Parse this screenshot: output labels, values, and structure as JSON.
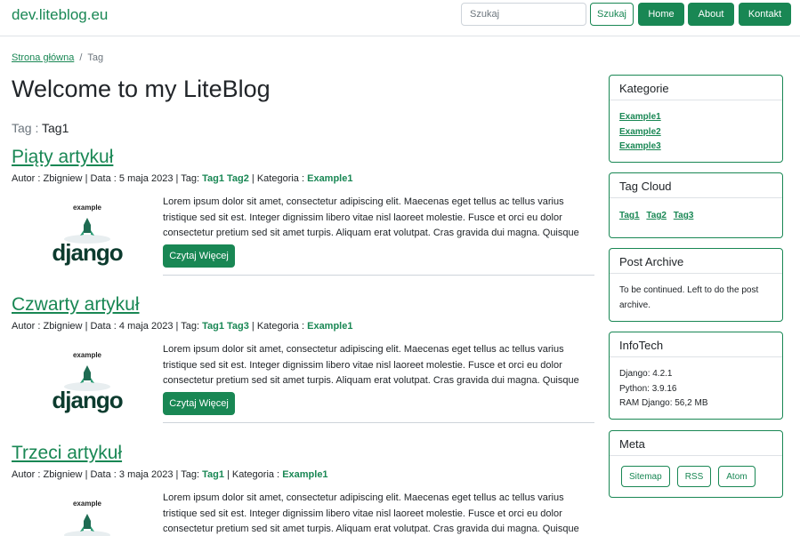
{
  "brand": "dev.liteblog.eu",
  "search": {
    "placeholder": "Szukaj",
    "button": "Szukaj"
  },
  "nav": {
    "home": "Home",
    "about": "About",
    "contact": "Kontakt"
  },
  "breadcrumb": {
    "home": "Strona główna",
    "separator": "/",
    "current": "Tag"
  },
  "page_title": "Welcome to my LiteBlog",
  "tag_filter": {
    "label": "Tag :",
    "value": "Tag1"
  },
  "post_labels": {
    "author": "Autor :",
    "date": "| Data :",
    "tag": "| Tag:",
    "category": "| Kategoria :",
    "read_more": "Czytaj Więcej",
    "image_caption": "example",
    "image_word": "django"
  },
  "posts": [
    {
      "title": "Piąty artykuł",
      "author": "Zbigniew",
      "date": "5 maja 2023",
      "tags": "Tag1 Tag2",
      "category": "Example1",
      "excerpt": "Lorem ipsum dolor sit amet, consectetur adipiscing elit. Maecenas eget tellus ac tellus varius tristique sed sit est. Integer dignissim libero vitae nisl laoreet molestie. Fusce et orci eu dolor consectetur pretium sed sit amet turpis. Aliquam erat volutpat. Cras gravida dui magna. Quisque porta q"
    },
    {
      "title": "Czwarty artykuł",
      "author": "Zbigniew",
      "date": "4 maja 2023",
      "tags": "Tag1 Tag3",
      "category": "Example1",
      "excerpt": "Lorem ipsum dolor sit amet, consectetur adipiscing elit. Maecenas eget tellus ac tellus varius tristique sed sit est. Integer dignissim libero vitae nisl laoreet molestie. Fusce et orci eu dolor consectetur pretium sed sit amet turpis. Aliquam erat volutpat. Cras gravida dui magna. Quisque porta q"
    },
    {
      "title": "Trzeci artykuł",
      "author": "Zbigniew",
      "date": "3 maja 2023",
      "tags": "Tag1",
      "category": "Example1",
      "excerpt": "Lorem ipsum dolor sit amet, consectetur adipiscing elit. Maecenas eget tellus ac tellus varius tristique sed sit est. Integer dignissim libero vitae nisl laoreet molestie. Fusce et orci eu dolor consectetur pretium sed sit amet turpis. Aliquam erat volutpat. Cras gravida dui magna. Quisque porta q"
    }
  ],
  "sidebar": {
    "categories": {
      "title": "Kategorie",
      "items": [
        "Example1",
        "Example2",
        "Example3"
      ]
    },
    "tag_cloud": {
      "title": "Tag Cloud",
      "items": [
        "Tag1",
        "Tag2",
        "Tag3"
      ]
    },
    "archive": {
      "title": "Post Archive",
      "text": "To be continued. Left to do the post archive."
    },
    "infotech": {
      "title": "InfoTech",
      "lines": [
        "Django: 4.2.1",
        "Python: 3.9.16",
        "RAM Django: 56,2 MB"
      ]
    },
    "meta": {
      "title": "Meta",
      "buttons": [
        "Sitemap",
        "RSS",
        "Atom"
      ]
    }
  },
  "colors": {
    "accent": "#198754",
    "text": "#212529",
    "muted": "#6c757d",
    "border": "#dee2e6"
  }
}
